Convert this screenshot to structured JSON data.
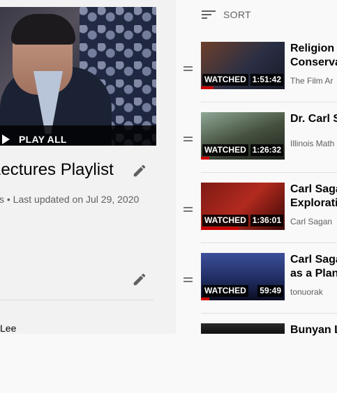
{
  "playlist": {
    "play_all_label": "PLAY ALL",
    "title": "Lectures Playlist",
    "meta": "s • Last updated on Jul 29, 2020",
    "owner": "Lee"
  },
  "sort": {
    "label": "SORT"
  },
  "items": [
    {
      "title_line1": "Religion a",
      "title_line2": "Conserva",
      "channel": "The Film Ar",
      "watched": "WATCHED",
      "duration": "1:51:42",
      "progress": 0.15
    },
    {
      "title_line1": "Dr. Carl S",
      "title_line2": "",
      "channel": "Illinois Math",
      "watched": "WATCHED",
      "duration": "1:26:32",
      "progress": 0.1
    },
    {
      "title_line1": "Carl Sagan",
      "title_line2": "Exploratio",
      "channel": "Carl Sagan",
      "watched": "WATCHED",
      "duration": "1:36:01",
      "progress": 0.45
    },
    {
      "title_line1": "Carl Saga",
      "title_line2": "as a Plane",
      "channel": "tonuorak",
      "watched": "WATCHED",
      "duration": "59:49",
      "progress": 0.1
    },
    {
      "title_line1": "Bunyan L",
      "title_line2": "",
      "channel": "",
      "watched": "",
      "duration": "",
      "progress": 0
    }
  ],
  "colors": {
    "progress": "#cc0000",
    "background": "#f9f9f9",
    "panel": "#f2f2f2"
  },
  "icons": {
    "play": "play-icon",
    "edit": "pencil-icon",
    "sort": "sort-icon",
    "drag": "drag-handle-icon"
  }
}
